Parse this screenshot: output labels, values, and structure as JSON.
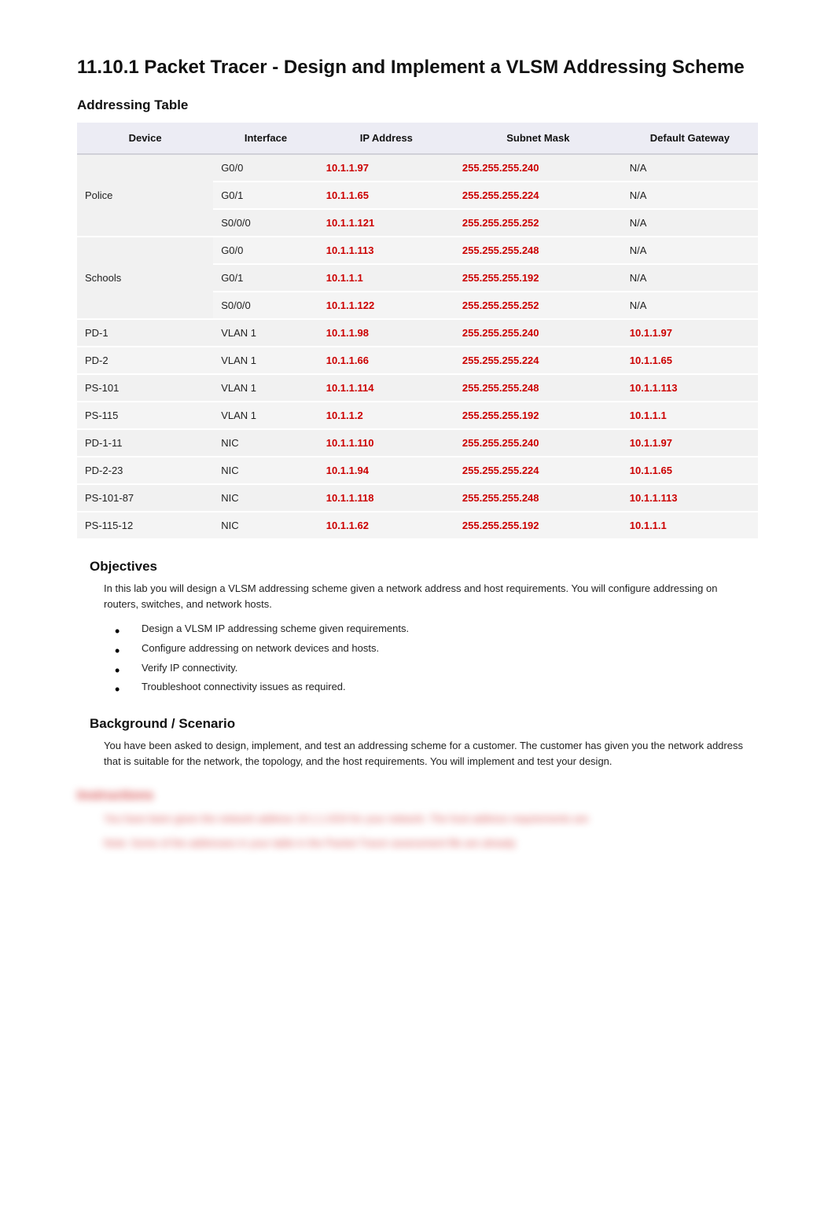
{
  "title": "11.10.1 Packet Tracer - Design and Implement a VLSM Addressing Scheme",
  "sections": {
    "addressing_table": "Addressing Table",
    "objectives": "Objectives",
    "background": "Background / Scenario"
  },
  "table": {
    "headers": {
      "device": "Device",
      "interface": "Interface",
      "ip": "IP Address",
      "mask": "Subnet Mask",
      "gateway": "Default Gateway"
    },
    "groups": [
      {
        "device": "Police",
        "rows": [
          {
            "if": "G0/0",
            "ip": "10.1.1.97",
            "mask": "255.255.255.240",
            "gw": "N/A",
            "gw_red": false
          },
          {
            "if": "G0/1",
            "ip": "10.1.1.65",
            "mask": "255.255.255.224",
            "gw": "N/A",
            "gw_red": false
          },
          {
            "if": "S0/0/0",
            "ip": "10.1.1.121",
            "mask": "255.255.255.252",
            "gw": "N/A",
            "gw_red": false
          }
        ]
      },
      {
        "device": "Schools",
        "rows": [
          {
            "if": "G0/0",
            "ip": "10.1.1.113",
            "mask": "255.255.255.248",
            "gw": "N/A",
            "gw_red": false
          },
          {
            "if": "G0/1",
            "ip": "10.1.1.1",
            "mask": "255.255.255.192",
            "gw": "N/A",
            "gw_red": false
          },
          {
            "if": "S0/0/0",
            "ip": "10.1.1.122",
            "mask": "255.255.255.252",
            "gw": "N/A",
            "gw_red": false
          }
        ]
      }
    ],
    "rows": [
      {
        "device": "PD-1",
        "if": "VLAN 1",
        "ip": "10.1.1.98",
        "mask": "255.255.255.240",
        "gw": "10.1.1.97",
        "gw_red": true
      },
      {
        "device": "PD-2",
        "if": "VLAN 1",
        "ip": "10.1.1.66",
        "mask": "255.255.255.224",
        "gw": "10.1.1.65",
        "gw_red": true
      },
      {
        "device": "PS-101",
        "if": "VLAN 1",
        "ip": "10.1.1.114",
        "mask": "255.255.255.248",
        "gw": "10.1.1.113",
        "gw_red": true
      },
      {
        "device": "PS-115",
        "if": "VLAN 1",
        "ip": "10.1.1.2",
        "mask": "255.255.255.192",
        "gw": "10.1.1.1",
        "gw_red": true
      },
      {
        "device": "PD-1-11",
        "if": "NIC",
        "ip": "10.1.1.110",
        "mask": "255.255.255.240",
        "gw": "10.1.1.97",
        "gw_red": true
      },
      {
        "device": "PD-2-23",
        "if": "NIC",
        "ip": "10.1.1.94",
        "mask": "255.255.255.224",
        "gw": "10.1.1.65",
        "gw_red": true
      },
      {
        "device": "PS-101-87",
        "if": "NIC",
        "ip": "10.1.1.118",
        "mask": "255.255.255.248",
        "gw": "10.1.1.113",
        "gw_red": true
      },
      {
        "device": "PS-115-12",
        "if": "NIC",
        "ip": "10.1.1.62",
        "mask": "255.255.255.192",
        "gw": "10.1.1.1",
        "gw_red": true
      }
    ]
  },
  "objectives": {
    "intro": "In this lab you will design a VLSM addressing scheme given a network address and host requirements. You will configure addressing on routers, switches, and network hosts.",
    "items": [
      "Design a VLSM IP addressing scheme given requirements.",
      "Configure addressing on network devices and hosts.",
      "Verify IP connectivity.",
      "Troubleshoot connectivity issues as required."
    ]
  },
  "background": {
    "text": "You have been asked to design, implement, and test an addressing scheme for a customer. The customer has given you the network address that is suitable for the network, the topology, and the host requirements. You will implement and test your design."
  },
  "blurred": {
    "heading": "Instructions",
    "line1": "You have been given the network address        10.1.1.0/24 for your network. The host address requirements are",
    "line2": "Note: Some of the addresses in your table in the Packet Tracer assessment file are already"
  }
}
